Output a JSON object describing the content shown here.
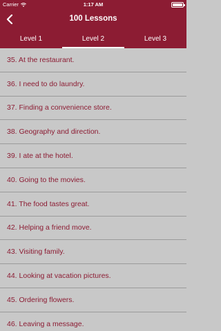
{
  "status_bar": {
    "carrier": "Carrier",
    "time": "1:17 AM",
    "battery_level": 1.0
  },
  "nav": {
    "back_icon": "chevron-left-icon",
    "title": "100 Lessons"
  },
  "tabs": [
    {
      "label": "Level 1",
      "active": false
    },
    {
      "label": "Level 2",
      "active": true
    },
    {
      "label": "Level 3",
      "active": false
    }
  ],
  "lessons": [
    "35. At the restaurant.",
    "36. I need to do laundry.",
    "37. Finding a convenience store.",
    "38. Geography and direction.",
    "39. I ate at the hotel.",
    "40. Going to the movies.",
    "41. The food tastes great.",
    "42. Helping a friend move.",
    "43. Visiting family.",
    "44. Looking at vacation pictures.",
    "45. Ordering flowers.",
    "46. Leaving a message."
  ],
  "colors": {
    "accent": "#8c1c33",
    "list_background": "#c8c8c8",
    "divider": "#9a9a9a"
  }
}
